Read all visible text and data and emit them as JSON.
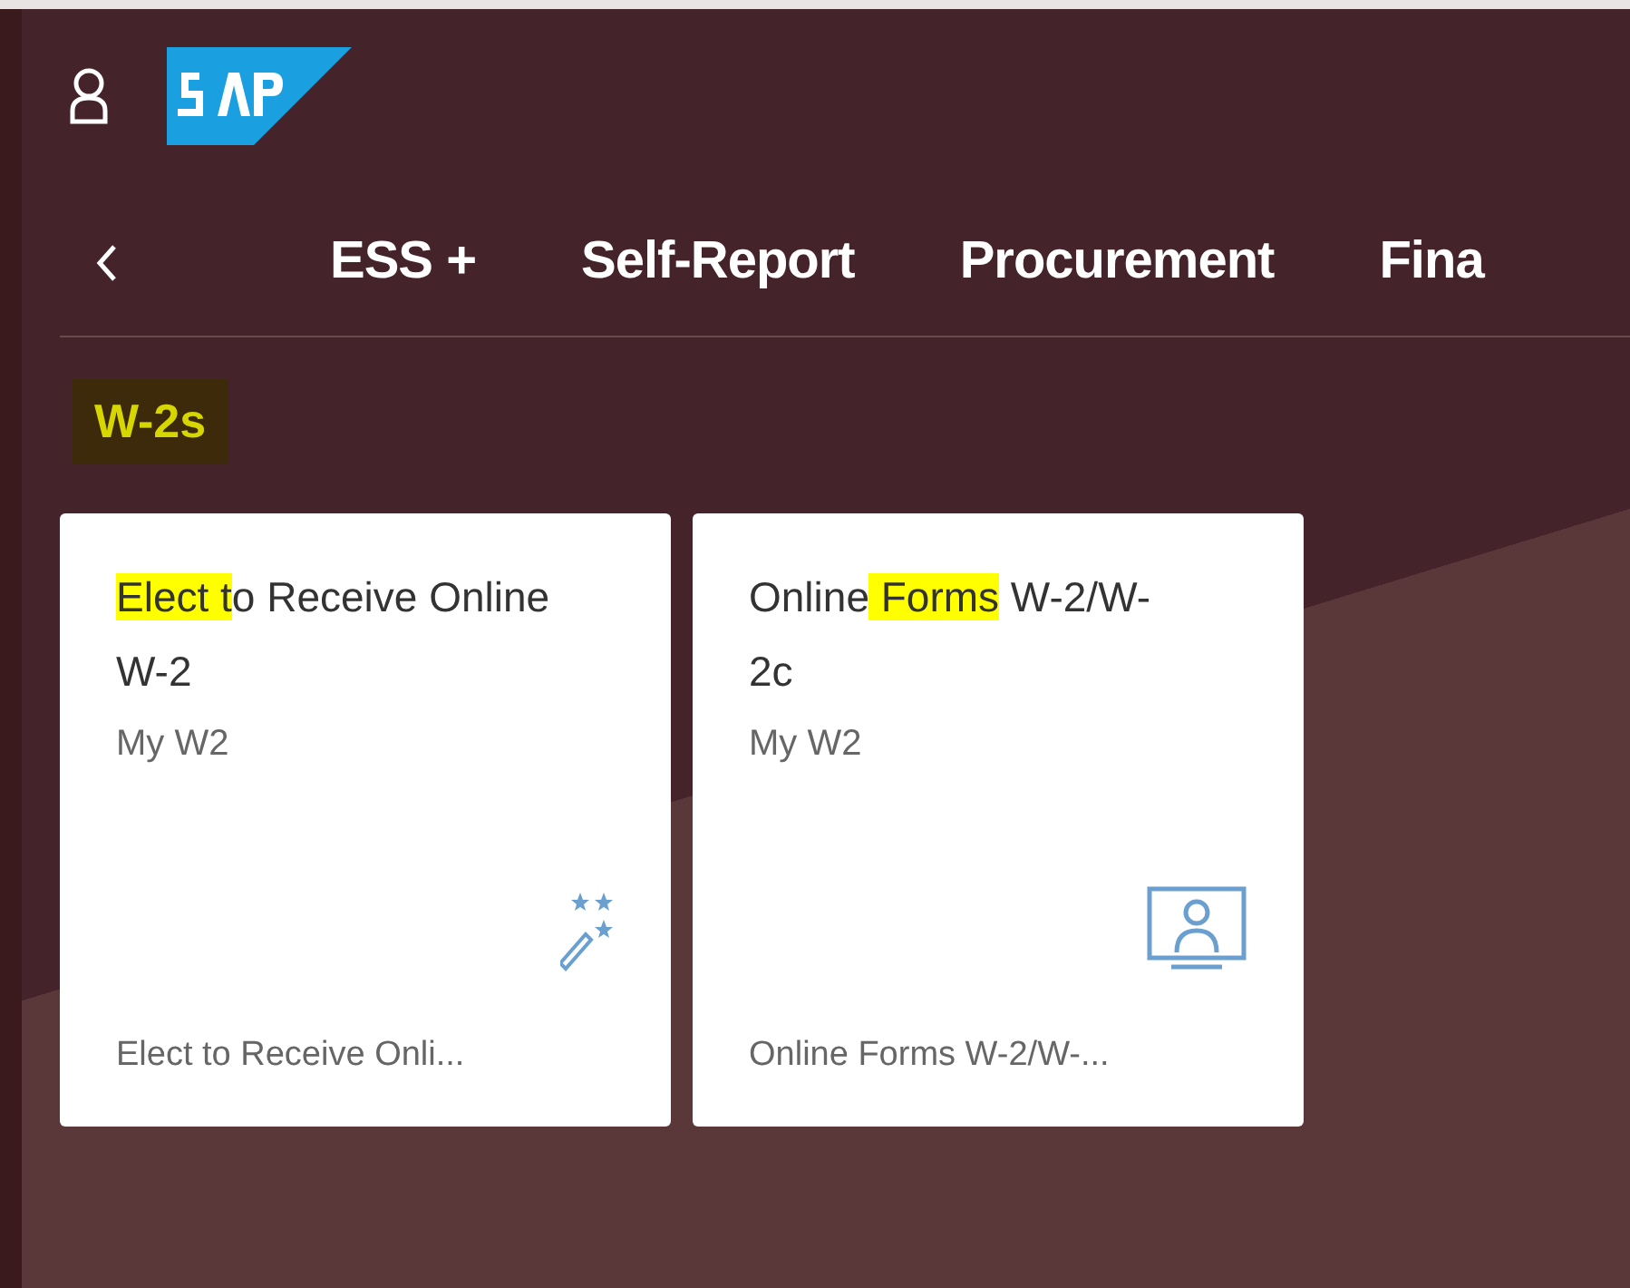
{
  "nav": {
    "items": [
      {
        "label": "ESS +",
        "selected": false
      },
      {
        "label": "Self-Report",
        "selected": false
      },
      {
        "label": "Procurement",
        "selected": false
      },
      {
        "label": "Fina",
        "selected": false
      }
    ]
  },
  "group": {
    "title": "W-2s",
    "highlighted": true
  },
  "tiles": [
    {
      "title": [
        {
          "text": "Elect t",
          "highlighted": true
        },
        {
          "text": "o Receive Online W-2",
          "highlighted": false
        }
      ],
      "subtitle": "My W2",
      "kind": "wand",
      "footer": "Elect to Receive Onli..."
    },
    {
      "title": [
        {
          "text": "Online",
          "highlighted": false
        },
        {
          "text": " Forms",
          "highlighted": true
        },
        {
          "text": " W-2/W-2c",
          "highlighted": false
        }
      ],
      "subtitle": "My W2",
      "kind": "screen",
      "footer": "Online Forms W-2/W-..."
    }
  ]
}
